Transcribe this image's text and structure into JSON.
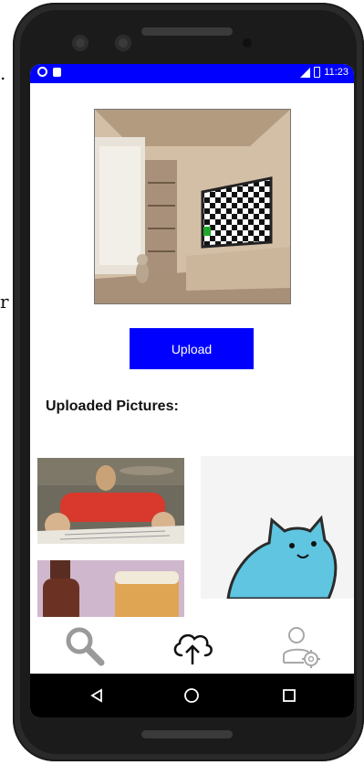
{
  "page_edge": {
    "glyph_top": "r"
  },
  "status_bar": {
    "background": "#0000ff",
    "time": "11:23",
    "left_icons": [
      "status-circle-icon",
      "status-lock-icon"
    ],
    "right_icons": [
      "signal-icon",
      "battery-icon"
    ]
  },
  "preview": {
    "description_icon": "room-with-tv-image"
  },
  "upload_button": {
    "label": "Upload",
    "color": "#0000ff"
  },
  "uploaded": {
    "title": "Uploaded Pictures:",
    "thumbnails": [
      "figure-with-paper-image",
      "blue-cat-sticker-image",
      "bottle-and-beer-image"
    ]
  },
  "bottom_nav": {
    "items": [
      "search-icon",
      "cloud-upload-icon",
      "user-settings-icon"
    ]
  },
  "system_nav": {
    "items": [
      "back-icon",
      "home-icon",
      "recents-icon"
    ]
  }
}
